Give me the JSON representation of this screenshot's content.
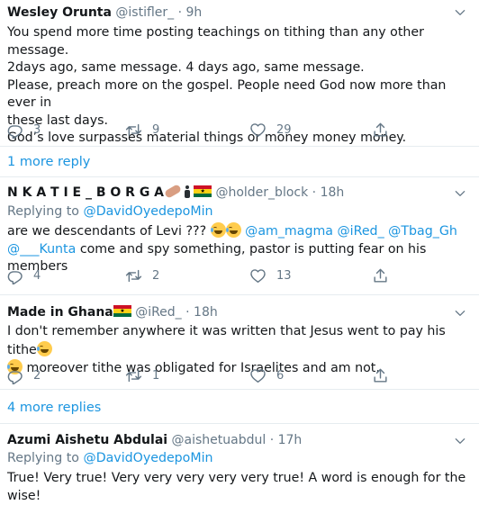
{
  "tweets": [
    {
      "name": "Wesley Orunta",
      "handle": "@istifler_",
      "time": "9h",
      "lines": [
        "You spend more time posting teachings on tithing than any other message.",
        "2days ago, same message. 4 days ago, same message.",
        "Please, preach more on the gospel. People need God now more than ever in",
        "these last days.",
        "God’s love surpasses material things or money money money."
      ],
      "replies": "3",
      "retweets": "9",
      "likes": "29",
      "more_replies": "1 more reply"
    },
    {
      "name": "N K A T I E _ B O R G A",
      "handle": "@holder_block",
      "time": "18h",
      "replying_prefix": "Replying to",
      "replying_to": "@DavidOyedepoMin",
      "line1_text": "are we  descendants  of Levi ???",
      "mentions_line1": "@am_magma @iRed_ @Tbag_Gh",
      "mention_line2": "@___Kunta",
      "line2_text": "come and spy something, pastor is putting fear on his members",
      "replies": "4",
      "retweets": "2",
      "likes": "13"
    },
    {
      "name": "Made in Ghana",
      "handle": "@iRed_",
      "time": "18h",
      "line1_text": "I don't remember anywhere it was written that Jesus went to pay his tithe",
      "line2_text": "moreover tithe was obligated for Israelites and am not.",
      "replies": "2",
      "retweets": "1",
      "likes": "6",
      "more_replies": "4 more replies"
    },
    {
      "name": "Azumi Aishetu Abdulai",
      "handle": "@aishetuabdul",
      "time": "17h",
      "replying_prefix": "Replying to",
      "replying_to": "@DavidOyedepoMin",
      "text": "True! Very true! Very very very very very true! A word is enough for the wise!"
    }
  ],
  "separator": "·",
  "colors": {
    "link": "#1b95e0",
    "muted": "#657786",
    "divider": "#e6ecf0"
  },
  "icons": [
    "reply-icon",
    "retweet-icon",
    "like-icon",
    "share-icon",
    "caret-down-icon"
  ]
}
